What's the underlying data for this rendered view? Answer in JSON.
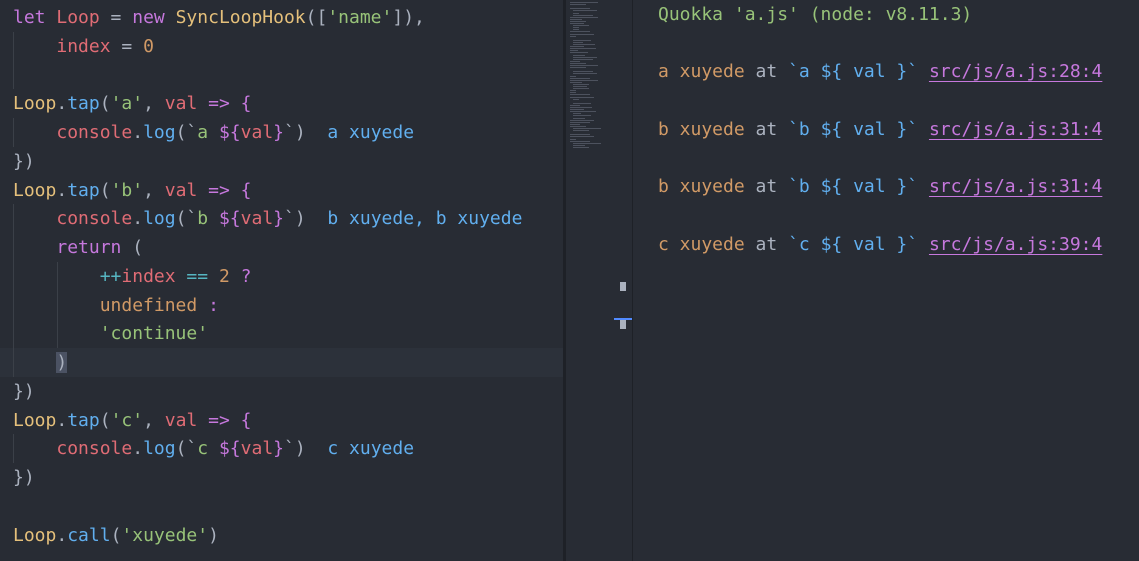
{
  "editor": {
    "lines": [
      [
        {
          "t": "let ",
          "c": "kw"
        },
        {
          "t": "Loop",
          "c": "var"
        },
        {
          "t": " = ",
          "c": "pun"
        },
        {
          "t": "new ",
          "c": "kw"
        },
        {
          "t": "SyncLoopHook",
          "c": "cls"
        },
        {
          "t": "([",
          "c": "pun"
        },
        {
          "t": "'name'",
          "c": "str"
        },
        {
          "t": "]),",
          "c": "pun"
        }
      ],
      [
        {
          "t": "    ",
          "c": "pun"
        },
        {
          "t": "index",
          "c": "var"
        },
        {
          "t": " = ",
          "c": "pun"
        },
        {
          "t": "0",
          "c": "num"
        }
      ],
      [],
      [
        {
          "t": "Loop",
          "c": "cls"
        },
        {
          "t": ".",
          "c": "pun"
        },
        {
          "t": "tap",
          "c": "fn"
        },
        {
          "t": "(",
          "c": "pun"
        },
        {
          "t": "'a'",
          "c": "str"
        },
        {
          "t": ", ",
          "c": "pun"
        },
        {
          "t": "val",
          "c": "var"
        },
        {
          "t": " => {",
          "c": "kw"
        }
      ],
      [
        {
          "t": "    ",
          "c": "pun"
        },
        {
          "t": "console",
          "c": "var"
        },
        {
          "t": ".",
          "c": "pun"
        },
        {
          "t": "log",
          "c": "fn"
        },
        {
          "t": "(`",
          "c": "pun"
        },
        {
          "t": "a ",
          "c": "tpl"
        },
        {
          "t": "${",
          "c": "kw"
        },
        {
          "t": "val",
          "c": "var"
        },
        {
          "t": "}",
          "c": "kw"
        },
        {
          "t": "`)",
          "c": "pun"
        },
        {
          "t": "  a xuyede",
          "c": "inline-res"
        }
      ],
      [
        {
          "t": "})",
          "c": "pun"
        }
      ],
      [
        {
          "t": "Loop",
          "c": "cls"
        },
        {
          "t": ".",
          "c": "pun"
        },
        {
          "t": "tap",
          "c": "fn"
        },
        {
          "t": "(",
          "c": "pun"
        },
        {
          "t": "'b'",
          "c": "str"
        },
        {
          "t": ", ",
          "c": "pun"
        },
        {
          "t": "val",
          "c": "var"
        },
        {
          "t": " => {",
          "c": "kw"
        }
      ],
      [
        {
          "t": "    ",
          "c": "pun"
        },
        {
          "t": "console",
          "c": "var"
        },
        {
          "t": ".",
          "c": "pun"
        },
        {
          "t": "log",
          "c": "fn"
        },
        {
          "t": "(`",
          "c": "pun"
        },
        {
          "t": "b ",
          "c": "tpl"
        },
        {
          "t": "${",
          "c": "kw"
        },
        {
          "t": "val",
          "c": "var"
        },
        {
          "t": "}",
          "c": "kw"
        },
        {
          "t": "`)",
          "c": "pun"
        },
        {
          "t": "  b xuyede, b xuyede",
          "c": "inline-res"
        }
      ],
      [
        {
          "t": "    ",
          "c": "pun"
        },
        {
          "t": "return",
          "c": "kw"
        },
        {
          "t": " (",
          "c": "pun"
        }
      ],
      [
        {
          "t": "        ",
          "c": "pun"
        },
        {
          "t": "++",
          "c": "op"
        },
        {
          "t": "index",
          "c": "var"
        },
        {
          "t": " == ",
          "c": "op"
        },
        {
          "t": "2",
          "c": "num"
        },
        {
          "t": " ?",
          "c": "kw"
        }
      ],
      [
        {
          "t": "        ",
          "c": "pun"
        },
        {
          "t": "undefined",
          "c": "num"
        },
        {
          "t": " :",
          "c": "kw"
        }
      ],
      [
        {
          "t": "        ",
          "c": "pun"
        },
        {
          "t": "'continue'",
          "c": "str"
        }
      ],
      [
        {
          "t": "    ",
          "c": "pun"
        },
        {
          "t": ")",
          "c": "sel-paren"
        }
      ],
      [
        {
          "t": "})",
          "c": "pun"
        }
      ],
      [
        {
          "t": "Loop",
          "c": "cls"
        },
        {
          "t": ".",
          "c": "pun"
        },
        {
          "t": "tap",
          "c": "fn"
        },
        {
          "t": "(",
          "c": "pun"
        },
        {
          "t": "'c'",
          "c": "str"
        },
        {
          "t": ", ",
          "c": "pun"
        },
        {
          "t": "val",
          "c": "var"
        },
        {
          "t": " => {",
          "c": "kw"
        }
      ],
      [
        {
          "t": "    ",
          "c": "pun"
        },
        {
          "t": "console",
          "c": "var"
        },
        {
          "t": ".",
          "c": "pun"
        },
        {
          "t": "log",
          "c": "fn"
        },
        {
          "t": "(`",
          "c": "pun"
        },
        {
          "t": "c ",
          "c": "tpl"
        },
        {
          "t": "${",
          "c": "kw"
        },
        {
          "t": "val",
          "c": "var"
        },
        {
          "t": "}",
          "c": "kw"
        },
        {
          "t": "`)",
          "c": "pun"
        },
        {
          "t": "  c xuyede",
          "c": "inline-res"
        }
      ],
      [
        {
          "t": "})",
          "c": "pun"
        }
      ],
      [],
      [
        {
          "t": "Loop",
          "c": "cls"
        },
        {
          "t": ".",
          "c": "pun"
        },
        {
          "t": "call",
          "c": "fn"
        },
        {
          "t": "(",
          "c": "pun"
        },
        {
          "t": "'xuyede'",
          "c": "str"
        },
        {
          "t": ")",
          "c": "pun"
        }
      ]
    ]
  },
  "output": {
    "header": "Quokka 'a.js' (node: v8.11.3)",
    "entries": [
      {
        "value": "a xuyede",
        "at": " at ",
        "expr": "`a ${ val }`",
        "link": "src/js/a.js:28:4"
      },
      {
        "value": "b xuyede",
        "at": " at ",
        "expr": "`b ${ val }`",
        "link": "src/js/a.js:31:4"
      },
      {
        "value": "b xuyede",
        "at": " at ",
        "expr": "`b ${ val }`",
        "link": "src/js/a.js:31:4"
      },
      {
        "value": "c xuyede",
        "at": " at ",
        "expr": "`c ${ val }`",
        "link": "src/js/a.js:39:4"
      }
    ]
  },
  "colors": {
    "background": "#282c34",
    "keyword": "#c678dd",
    "string": "#98c379",
    "function": "#61afef",
    "variable": "#e06c75",
    "number": "#d19a66",
    "class": "#e5c07b"
  }
}
